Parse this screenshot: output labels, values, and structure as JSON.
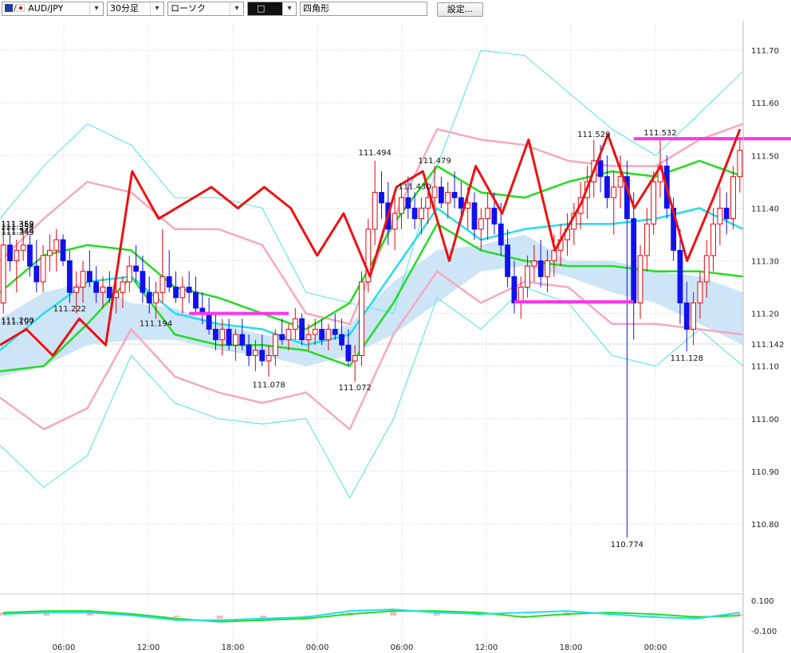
{
  "toolbar": {
    "symbol": "AUD/JPY",
    "timeframe": "30分足",
    "chart_style": "ローソク",
    "draw_tool_value": "□",
    "shape_name": "四角形",
    "settings_label": "設定..."
  },
  "colors": {
    "bull_candle": "#e8000a",
    "bear_candle": "#1111ee",
    "bb_outer": "#66e6ec",
    "bb_mid": "#f7a8c0",
    "ema_green": "#22dd22",
    "ema_cyan": "#22ddee",
    "oscillator_red": "#ee1111",
    "cloud": "#c8e2f6",
    "hline": "#ff33ee"
  },
  "chart_data": {
    "type": "candlestick",
    "ylim": [
      110.67,
      111.75
    ],
    "y_ticks": [
      "111.70",
      "111.60",
      "111.50",
      "111.40",
      "111.30",
      "111.20",
      "111.10",
      "111.00",
      "110.90",
      "110.80"
    ],
    "x_ticks": [
      "06:00",
      "12:00",
      "18:00",
      "00:00",
      "06:00",
      "12:00",
      "18:00",
      "00:00"
    ],
    "grid": true,
    "price_annotations": [
      {
        "label": "111.359",
        "price": 111.359
      },
      {
        "label": "111.354",
        "price": 111.354
      },
      {
        "label": "111.358",
        "price": 111.358
      },
      {
        "label": "111.200",
        "price": 111.2
      },
      {
        "label": "111.194",
        "price": 111.194
      },
      {
        "label": "111.078",
        "price": 111.078
      },
      {
        "label": "111.222",
        "price": 111.222
      },
      {
        "label": "111.072",
        "price": 111.072
      },
      {
        "label": "111.494",
        "price": 111.494
      },
      {
        "label": "111.346",
        "price": 111.346
      },
      {
        "label": "111.479",
        "price": 111.479
      },
      {
        "label": "111.343",
        "price": 111.343
      },
      {
        "label": "111.430",
        "price": 111.43
      },
      {
        "label": "111.197",
        "price": 111.197
      },
      {
        "label": "111.529",
        "price": 111.529
      },
      {
        "label": "111.532",
        "price": 111.532
      },
      {
        "label": "110.774",
        "price": 110.774
      },
      {
        "label": "111.128",
        "price": 111.128
      }
    ],
    "current_price_label": "111.142",
    "horizontal_lines": [
      {
        "price": 111.532,
        "t0": 95,
        "t1": 126
      },
      {
        "price": 111.128,
        "t0": 204,
        "t1": 226
      },
      {
        "price": 111.222,
        "t0": 77,
        "t1": 95
      },
      {
        "price": 111.2,
        "t0": 28,
        "t1": 43
      }
    ],
    "candles": [
      [
        111.22,
        111.36,
        111.2,
        111.33
      ],
      [
        111.33,
        111.35,
        111.28,
        111.3
      ],
      [
        111.3,
        111.34,
        111.24,
        111.32
      ],
      [
        111.32,
        111.36,
        111.3,
        111.33
      ],
      [
        111.33,
        111.35,
        111.27,
        111.29
      ],
      [
        111.29,
        111.34,
        111.24,
        111.26
      ],
      [
        111.26,
        111.33,
        111.24,
        111.31
      ],
      [
        111.31,
        111.35,
        111.28,
        111.32
      ],
      [
        111.32,
        111.36,
        111.28,
        111.34
      ],
      [
        111.34,
        111.35,
        111.29,
        111.3
      ],
      [
        111.3,
        111.32,
        111.22,
        111.24
      ],
      [
        111.24,
        111.28,
        111.2,
        111.25
      ],
      [
        111.25,
        111.3,
        111.22,
        111.28
      ],
      [
        111.28,
        111.32,
        111.25,
        111.26
      ],
      [
        111.26,
        111.29,
        111.22,
        111.24
      ],
      [
        111.24,
        111.27,
        111.21,
        111.25
      ],
      [
        111.25,
        111.28,
        111.22,
        111.23
      ],
      [
        111.23,
        111.26,
        111.2,
        111.24
      ],
      [
        111.24,
        111.27,
        111.21,
        111.26
      ],
      [
        111.26,
        111.31,
        111.24,
        111.29
      ],
      [
        111.29,
        111.33,
        111.26,
        111.28
      ],
      [
        111.28,
        111.31,
        111.22,
        111.24
      ],
      [
        111.24,
        111.27,
        111.2,
        111.22
      ],
      [
        111.22,
        111.26,
        111.19,
        111.24
      ],
      [
        111.24,
        111.36,
        111.22,
        111.27
      ],
      [
        111.27,
        111.32,
        111.24,
        111.25
      ],
      [
        111.25,
        111.28,
        111.22,
        111.23
      ],
      [
        111.23,
        111.27,
        111.2,
        111.25
      ],
      [
        111.25,
        111.28,
        111.22,
        111.24
      ],
      [
        111.24,
        111.27,
        111.2,
        111.21
      ],
      [
        111.21,
        111.24,
        111.18,
        111.2
      ],
      [
        111.2,
        111.23,
        111.16,
        111.17
      ],
      [
        111.17,
        111.2,
        111.13,
        111.15
      ],
      [
        111.15,
        111.19,
        111.12,
        111.17
      ],
      [
        111.17,
        111.19,
        111.13,
        111.14
      ],
      [
        111.14,
        111.17,
        111.11,
        111.16
      ],
      [
        111.16,
        111.19,
        111.13,
        111.14
      ],
      [
        111.14,
        111.16,
        111.1,
        111.12
      ],
      [
        111.12,
        111.15,
        111.09,
        111.13
      ],
      [
        111.13,
        111.16,
        111.1,
        111.11
      ],
      [
        111.11,
        111.14,
        111.08,
        111.12
      ],
      [
        111.12,
        111.17,
        111.1,
        111.16
      ],
      [
        111.16,
        111.19,
        111.14,
        111.15
      ],
      [
        111.15,
        111.18,
        111.13,
        111.17
      ],
      [
        111.17,
        111.21,
        111.15,
        111.19
      ],
      [
        111.19,
        111.2,
        111.14,
        111.15
      ],
      [
        111.15,
        111.18,
        111.13,
        111.16
      ],
      [
        111.16,
        111.19,
        111.14,
        111.17
      ],
      [
        111.17,
        111.19,
        111.14,
        111.15
      ],
      [
        111.15,
        111.18,
        111.13,
        111.17
      ],
      [
        111.17,
        111.2,
        111.15,
        111.16
      ],
      [
        111.16,
        111.19,
        111.13,
        111.14
      ],
      [
        111.14,
        111.17,
        111.1,
        111.11
      ],
      [
        111.11,
        111.14,
        111.07,
        111.12
      ],
      [
        111.12,
        111.28,
        111.1,
        111.26
      ],
      [
        111.26,
        111.38,
        111.24,
        111.36
      ],
      [
        111.36,
        111.49,
        111.33,
        111.43
      ],
      [
        111.43,
        111.47,
        111.38,
        111.41
      ],
      [
        111.41,
        111.45,
        111.33,
        111.36
      ],
      [
        111.36,
        111.42,
        111.32,
        111.39
      ],
      [
        111.39,
        111.44,
        111.36,
        111.42
      ],
      [
        111.42,
        111.46,
        111.38,
        111.4
      ],
      [
        111.4,
        111.43,
        111.36,
        111.38
      ],
      [
        111.38,
        111.42,
        111.35,
        111.4
      ],
      [
        111.4,
        111.44,
        111.37,
        111.42
      ],
      [
        111.42,
        111.48,
        111.39,
        111.44
      ],
      [
        111.44,
        111.46,
        111.4,
        111.41
      ],
      [
        111.41,
        111.45,
        111.38,
        111.43
      ],
      [
        111.43,
        111.47,
        111.4,
        111.42
      ],
      [
        111.42,
        111.45,
        111.38,
        111.4
      ],
      [
        111.4,
        111.44,
        111.36,
        111.41
      ],
      [
        111.41,
        111.43,
        111.34,
        111.36
      ],
      [
        111.36,
        111.4,
        111.32,
        111.38
      ],
      [
        111.38,
        111.43,
        111.34,
        111.4
      ],
      [
        111.4,
        111.43,
        111.35,
        111.37
      ],
      [
        111.37,
        111.41,
        111.31,
        111.33
      ],
      [
        111.33,
        111.36,
        111.25,
        111.27
      ],
      [
        111.27,
        111.3,
        111.2,
        111.22
      ],
      [
        111.22,
        111.27,
        111.19,
        111.25
      ],
      [
        111.25,
        111.31,
        111.23,
        111.29
      ],
      [
        111.29,
        111.33,
        111.26,
        111.3
      ],
      [
        111.3,
        111.34,
        111.25,
        111.27
      ],
      [
        111.27,
        111.32,
        111.24,
        111.3
      ],
      [
        111.3,
        111.35,
        111.27,
        111.32
      ],
      [
        111.32,
        111.37,
        111.29,
        111.34
      ],
      [
        111.34,
        111.39,
        111.31,
        111.36
      ],
      [
        111.36,
        111.41,
        111.33,
        111.39
      ],
      [
        111.39,
        111.45,
        111.36,
        111.42
      ],
      [
        111.42,
        111.48,
        111.38,
        111.45
      ],
      [
        111.45,
        111.53,
        111.42,
        111.49
      ],
      [
        111.49,
        111.52,
        111.43,
        111.46
      ],
      [
        111.46,
        111.5,
        111.4,
        111.42
      ],
      [
        111.42,
        111.47,
        111.35,
        111.44
      ],
      [
        111.44,
        111.5,
        111.4,
        111.46
      ],
      [
        111.46,
        111.49,
        110.774,
        111.38
      ],
      [
        111.38,
        111.43,
        111.15,
        111.22
      ],
      [
        111.22,
        111.33,
        111.19,
        111.31
      ],
      [
        111.31,
        111.4,
        111.28,
        111.37
      ],
      [
        111.37,
        111.47,
        111.35,
        111.45
      ],
      [
        111.45,
        111.532,
        111.42,
        111.48
      ],
      [
        111.48,
        111.5,
        111.38,
        111.4
      ],
      [
        111.4,
        111.42,
        111.3,
        111.32
      ],
      [
        111.32,
        111.36,
        111.18,
        111.22
      ],
      [
        111.22,
        111.26,
        111.128,
        111.17
      ],
      [
        111.17,
        111.24,
        111.14,
        111.22
      ],
      [
        111.22,
        111.28,
        111.19,
        111.26
      ],
      [
        111.26,
        111.34,
        111.23,
        111.31
      ],
      [
        111.31,
        111.4,
        111.28,
        111.37
      ],
      [
        111.37,
        111.44,
        111.33,
        111.4
      ],
      [
        111.4,
        111.43,
        111.35,
        111.38
      ],
      [
        111.38,
        111.48,
        111.36,
        111.46
      ],
      [
        111.46,
        111.53,
        111.43,
        111.51
      ]
    ],
    "bollinger_outer_upper": [
      111.38,
      111.48,
      111.56,
      111.52,
      111.42,
      111.42,
      111.4,
      111.24,
      111.22,
      111.2,
      111.48,
      111.7,
      111.69,
      111.62,
      111.55,
      111.5,
      111.58,
      111.66
    ],
    "bollinger_outer_lower": [
      110.95,
      110.87,
      110.93,
      111.12,
      111.03,
      111.0,
      110.99,
      111.0,
      110.85,
      111.0,
      111.23,
      111.17,
      111.25,
      111.22,
      111.12,
      111.1,
      111.17,
      111.1
    ],
    "bollinger_inner_upper": [
      111.3,
      111.38,
      111.45,
      111.43,
      111.36,
      111.36,
      111.33,
      111.2,
      111.18,
      111.38,
      111.55,
      111.53,
      111.52,
      111.49,
      111.48,
      111.48,
      111.53,
      111.56
    ],
    "bollinger_inner_lower": [
      111.04,
      110.98,
      111.02,
      111.17,
      111.08,
      111.05,
      111.03,
      111.05,
      110.98,
      111.16,
      111.28,
      111.22,
      111.26,
      111.25,
      111.18,
      111.18,
      111.17,
      111.16
    ],
    "ema_green_upper": [
      111.24,
      111.31,
      111.33,
      111.32,
      111.25,
      111.23,
      111.2,
      111.17,
      111.22,
      111.37,
      111.48,
      111.43,
      111.42,
      111.45,
      111.47,
      111.46,
      111.49,
      111.46
    ],
    "ema_green_lower": [
      111.09,
      111.1,
      111.18,
      111.27,
      111.16,
      111.14,
      111.14,
      111.13,
      111.1,
      111.22,
      111.37,
      111.32,
      111.3,
      111.29,
      111.29,
      111.28,
      111.28,
      111.27
    ],
    "ema_cyan": [
      111.13,
      111.2,
      111.26,
      111.27,
      111.2,
      111.18,
      111.17,
      111.14,
      111.16,
      111.28,
      111.4,
      111.34,
      111.36,
      111.37,
      111.37,
      111.38,
      111.4,
      111.36
    ],
    "oscillator_red": [
      111.14,
      111.17,
      111.12,
      111.19,
      111.14,
      111.47,
      111.38,
      111.41,
      111.44,
      111.4,
      111.44,
      111.4,
      111.31,
      111.39,
      111.27,
      111.44,
      111.47,
      111.3,
      111.48,
      111.39,
      111.53,
      111.32,
      111.41,
      111.54,
      111.4,
      111.48,
      111.3,
      111.42,
      111.55
    ],
    "cloud_upper": [
      111.19,
      111.24,
      111.26,
      111.22,
      111.21,
      111.18,
      111.16,
      111.15,
      111.18,
      111.26,
      111.32,
      111.33,
      111.35,
      111.3,
      111.3,
      111.28,
      111.27,
      111.24
    ],
    "cloud_lower": [
      111.08,
      111.1,
      111.14,
      111.15,
      111.15,
      111.13,
      111.12,
      111.1,
      111.12,
      111.16,
      111.22,
      111.28,
      111.29,
      111.27,
      111.24,
      111.22,
      111.18,
      111.14
    ],
    "sub_panel": {
      "y_ticks": [
        "0.100",
        "-0.100"
      ],
      "ylim": [
        -0.13,
        0.13
      ],
      "line_green": [
        0.02,
        0.03,
        0.03,
        0.01,
        -0.02,
        -0.04,
        -0.03,
        -0.02,
        0.01,
        0.03,
        0.03,
        0.02,
        -0.01,
        0.01,
        0.02,
        0.01,
        -0.01,
        0.0
      ],
      "line_cyan": [
        0.01,
        0.02,
        0.02,
        0.0,
        -0.03,
        -0.03,
        -0.02,
        -0.01,
        0.03,
        0.04,
        0.02,
        0.01,
        0.02,
        0.03,
        0.01,
        -0.01,
        -0.02,
        0.02
      ],
      "histogram": [
        0.02,
        0.03,
        0.02,
        0.01,
        -0.01,
        -0.02,
        -0.02,
        -0.01,
        0.02,
        0.04,
        0.03,
        0.02,
        0.0,
        0.02,
        0.02,
        0.0,
        -0.01,
        0.01
      ]
    }
  }
}
